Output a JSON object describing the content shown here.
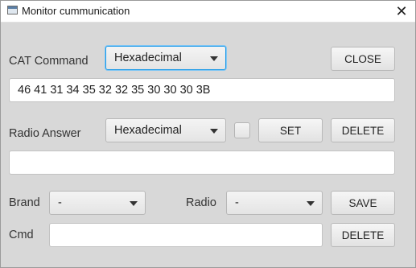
{
  "window": {
    "title": "Monitor cummunication"
  },
  "cat": {
    "label": "CAT Command",
    "format": "Hexadecimal",
    "command_value": "46 41 31 34 35 32 32 35 30 30 30 3B",
    "close_label": "CLOSE"
  },
  "answer": {
    "label": "Radio Answer",
    "format": "Hexadecimal",
    "checked": false,
    "set_label": "SET",
    "delete_label": "DELETE",
    "value": ""
  },
  "brand": {
    "label": "Brand",
    "value": "-"
  },
  "radio": {
    "label": "Radio",
    "value": "-"
  },
  "save_label": "SAVE",
  "cmd": {
    "label": "Cmd",
    "value": "",
    "delete_label": "DELETE"
  },
  "colors": {
    "background": "#d8d8d8",
    "focus": "#1f9ae8"
  }
}
